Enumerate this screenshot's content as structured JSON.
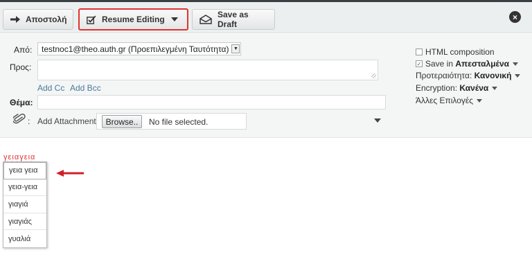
{
  "toolbar": {
    "send_label": "Αποστολή",
    "resume_label": "Resume Editing",
    "draft_label": "Save as Draft"
  },
  "headers": {
    "from_label": "Από:",
    "from_value": "testnoc1@theo.auth.gr (Προεπιλεγμένη Ταυτότητα)",
    "to_label": "Προς:",
    "add_cc": "Add Cc",
    "add_bcc": "Add Bcc",
    "subject_label": "Θέμα:",
    "attach_colon": ":",
    "add_attachment": "Add Attachment",
    "browse_label": "Browse..",
    "no_file": "No file selected."
  },
  "options": {
    "html_composition": "HTML composition",
    "save_in_prefix": "Save in",
    "save_in_folder": "Απεσταλμένα",
    "priority_label": "Προτεραιότητα:",
    "priority_value": "Κανονική",
    "encryption_label": "Encryption:",
    "encryption_value": "Κανένα",
    "other_options": "Άλλες Επιλογές"
  },
  "editor": {
    "misspelled_word": "γειαγεια",
    "suggestions": [
      "γεια γεια",
      "γεια-γεια",
      "γιαγιά",
      "γιαγιάς",
      "γυαλιά"
    ]
  },
  "states": {
    "html_composition_checked": false,
    "save_in_checked": true
  },
  "colors": {
    "highlight_border": "#e0322f",
    "arrow": "#d0202a",
    "link": "#4a7a9c"
  }
}
